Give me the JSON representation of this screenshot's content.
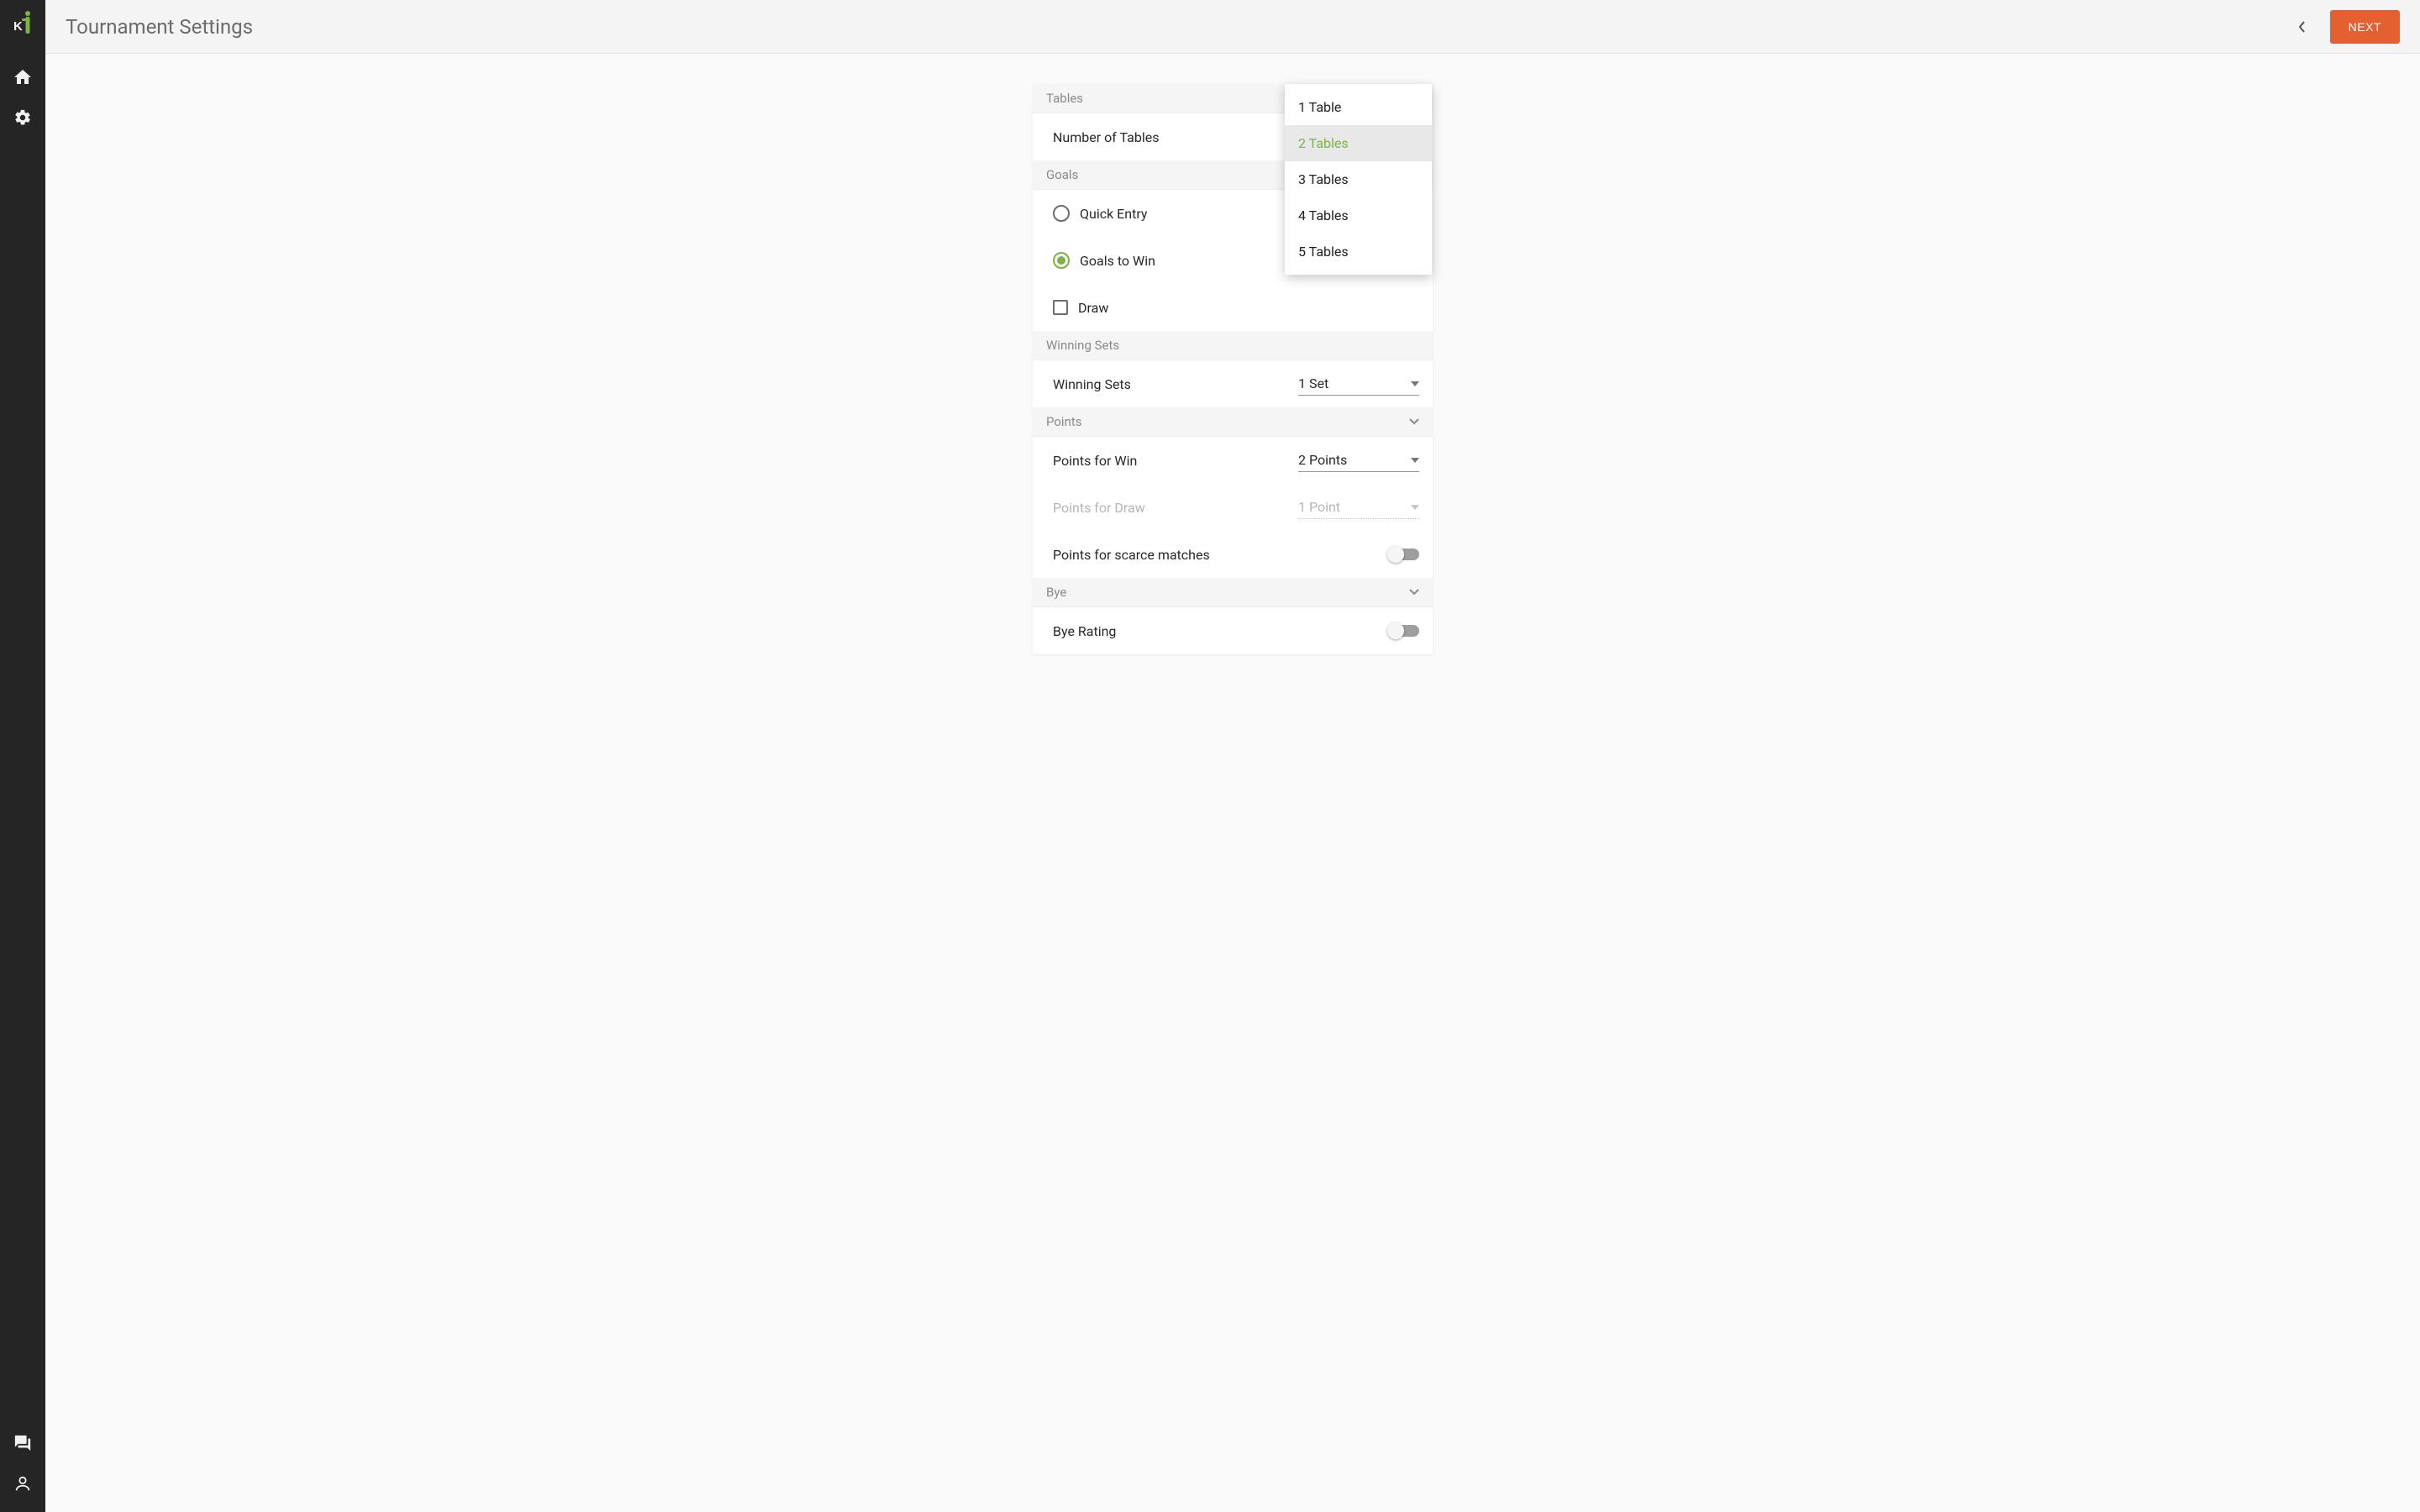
{
  "header": {
    "title": "Tournament Settings",
    "next_label": "NEXT"
  },
  "colors": {
    "accent_green": "#7cb342",
    "accent_orange": "#e46031"
  },
  "tables": {
    "header": "Tables",
    "row_label": "Number of Tables",
    "selected": "2 Tables",
    "options": [
      "1 Table",
      "2 Tables",
      "3 Tables",
      "4 Tables",
      "5 Tables"
    ]
  },
  "goals": {
    "header": "Goals",
    "quick_entry": "Quick Entry",
    "goals_to_win": "Goals to Win",
    "draw": "Draw",
    "selected_radio": "goals_to_win",
    "draw_checked": false
  },
  "winning_sets": {
    "header": "Winning Sets",
    "row_label": "Winning Sets",
    "value": "1 Set"
  },
  "points": {
    "header": "Points",
    "win_label": "Points for Win",
    "win_value": "2 Points",
    "draw_label": "Points for Draw",
    "draw_value": "1 Point",
    "scarce_label": "Points for scarce matches",
    "scarce_on": false
  },
  "bye": {
    "header": "Bye",
    "rating_label": "Bye Rating",
    "rating_on": false
  }
}
